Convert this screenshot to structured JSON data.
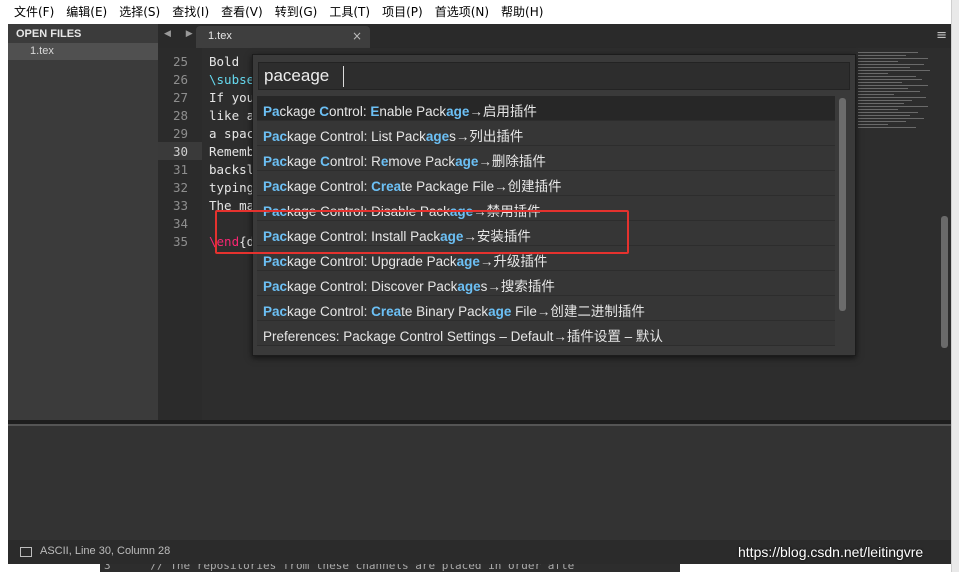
{
  "menubar": {
    "items": [
      {
        "label": "文件(F)"
      },
      {
        "label": "编辑(E)"
      },
      {
        "label": "选择(S)"
      },
      {
        "label": "查找(I)"
      },
      {
        "label": "查看(V)"
      },
      {
        "label": "转到(G)"
      },
      {
        "label": "工具(T)"
      },
      {
        "label": "项目(P)"
      },
      {
        "label": "首选项(N)"
      },
      {
        "label": "帮助(H)"
      }
    ]
  },
  "sidebar": {
    "header": "OPEN FILES",
    "files": [
      {
        "label": "1.tex"
      }
    ]
  },
  "tabbar": {
    "nav_arrows": "◀ ▶",
    "tab_title": "1.tex",
    "close_glyph": "×",
    "menu_glyph": "≡"
  },
  "gutter": {
    "line_numbers": [
      "25",
      "26",
      "27",
      "28",
      "29",
      "30",
      "31",
      "32",
      "33",
      "34",
      "35"
    ],
    "current_line": "30"
  },
  "editor": {
    "lines": [
      {
        "num": "25",
        "text": "Bold"
      },
      {
        "num": "26",
        "text": "\\subse"
      },
      {
        "num": "27",
        "text": "If you"
      },
      {
        "num": "28",
        "text": "like a"
      },
      {
        "num": "29",
        "text": "a spac"
      },
      {
        "num": "30",
        "text": "Rememb"
      },
      {
        "num": "31",
        "text": "backsl"
      },
      {
        "num": "32",
        "text": "typing"
      },
      {
        "num": "33",
        "text": "The ma"
      },
      {
        "num": "34",
        "text": ""
      },
      {
        "num": "35",
        "text_cmd": "\\end",
        "text_rest": "{d"
      }
    ]
  },
  "palette": {
    "query": "paceage",
    "items": [
      {
        "parts": [
          {
            "t": "Pa",
            "m": 1
          },
          {
            "t": "ckage ",
            "m": 0
          },
          {
            "t": "C",
            "m": 1
          },
          {
            "t": "ontrol: ",
            "m": 0
          },
          {
            "t": "E",
            "m": 1
          },
          {
            "t": "nable Pack",
            "m": 0
          },
          {
            "t": "age",
            "m": 1
          },
          {
            "t": "→启用插件",
            "m": 0
          }
        ]
      },
      {
        "parts": [
          {
            "t": "Pac",
            "m": 1
          },
          {
            "t": "kage Control: List Pack",
            "m": 0
          },
          {
            "t": "age",
            "m": 1
          },
          {
            "t": "s→列出插件",
            "m": 0
          }
        ]
      },
      {
        "parts": [
          {
            "t": "Pac",
            "m": 1
          },
          {
            "t": "kage ",
            "m": 0
          },
          {
            "t": "C",
            "m": 1
          },
          {
            "t": "ontrol: R",
            "m": 0
          },
          {
            "t": "e",
            "m": 1
          },
          {
            "t": "move Pack",
            "m": 0
          },
          {
            "t": "age",
            "m": 1
          },
          {
            "t": "→删除插件",
            "m": 0
          }
        ]
      },
      {
        "parts": [
          {
            "t": "Pac",
            "m": 1
          },
          {
            "t": "kage Control: ",
            "m": 0
          },
          {
            "t": "Crea",
            "m": 1
          },
          {
            "t": "te Package File→创建插件",
            "m": 0
          }
        ]
      },
      {
        "parts": [
          {
            "t": "Pac",
            "m": 1
          },
          {
            "t": "kage Control: Disable Pack",
            "m": 0
          },
          {
            "t": "age",
            "m": 1
          },
          {
            "t": "→禁用插件",
            "m": 0
          }
        ]
      },
      {
        "parts": [
          {
            "t": "Pac",
            "m": 1
          },
          {
            "t": "kage Control: Install Pack",
            "m": 0
          },
          {
            "t": "age",
            "m": 1
          },
          {
            "t": "→安装插件",
            "m": 0
          }
        ]
      },
      {
        "parts": [
          {
            "t": "Pac",
            "m": 1
          },
          {
            "t": "kage Control: Upgrade Pack",
            "m": 0
          },
          {
            "t": "age",
            "m": 1
          },
          {
            "t": "→升级插件",
            "m": 0
          }
        ]
      },
      {
        "parts": [
          {
            "t": "Pac",
            "m": 1
          },
          {
            "t": "kage Control: Discover Pack",
            "m": 0
          },
          {
            "t": "age",
            "m": 1
          },
          {
            "t": "s→搜索插件",
            "m": 0
          }
        ]
      },
      {
        "parts": [
          {
            "t": "Pac",
            "m": 1
          },
          {
            "t": "kage Control: ",
            "m": 0
          },
          {
            "t": "Crea",
            "m": 1
          },
          {
            "t": "te Binary Pack",
            "m": 0
          },
          {
            "t": "age",
            "m": 1
          },
          {
            "t": " File→创建二进制插件",
            "m": 0
          }
        ]
      },
      {
        "parts": [
          {
            "t": "Preferences: Package Control Settings – Default→插件设置 – 默认",
            "m": 0
          }
        ]
      }
    ],
    "selected_index": 0
  },
  "statusbar": {
    "text": "ASCII, Line 30, Column 28"
  },
  "watermark": "https://blog.csdn.net/leitingvre",
  "background_code": "3      // The repositories from these channels are placed in order afte",
  "colors": {
    "match_highlight": "#6cc0f5",
    "annotation_red": "#e5322e",
    "latex_command": "#66d9ef",
    "latex_env": "#f92672"
  }
}
